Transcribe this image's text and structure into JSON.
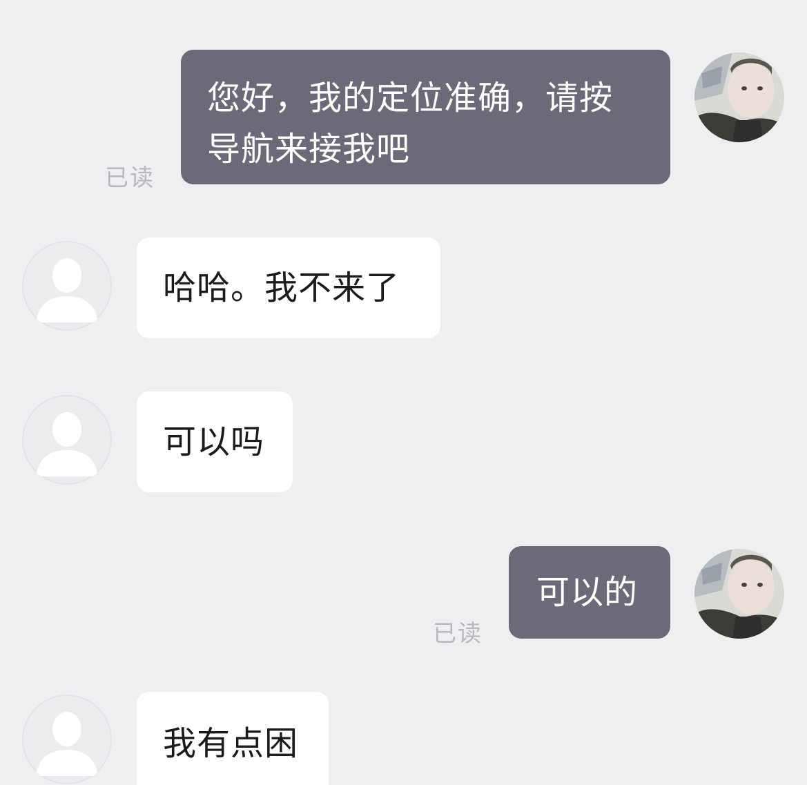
{
  "colors": {
    "background": "#efeff2",
    "outgoing_bubble": "#6b6a76",
    "incoming_bubble": "#ffffff",
    "read_text": "#b9b9bd"
  },
  "messages": [
    {
      "direction": "outgoing",
      "text": "您好，我的定位准确，请按导航来接我吧",
      "status": "已读",
      "avatar_icon": "user-photo-avatar-icon"
    },
    {
      "direction": "incoming",
      "text": "哈哈。我不来了",
      "avatar_icon": "default-person-avatar-icon"
    },
    {
      "direction": "incoming",
      "text": "可以吗",
      "avatar_icon": "default-person-avatar-icon"
    },
    {
      "direction": "outgoing",
      "text": "可以的",
      "status": "已读",
      "avatar_icon": "user-photo-avatar-icon"
    },
    {
      "direction": "incoming",
      "text": "我有点困",
      "avatar_icon": "default-person-avatar-icon"
    }
  ]
}
